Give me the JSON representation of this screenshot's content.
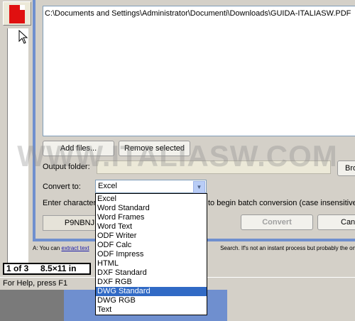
{
  "file_list": {
    "items": [
      "C:\\Documents and Settings\\Administrator\\Documenti\\Downloads\\GUIDA-ITALIASW.PDF"
    ]
  },
  "buttons": {
    "add_files": "Add files...",
    "remove_selected": "Remove selected",
    "browse": "Bro",
    "convert": "Convert",
    "cancel": "Can"
  },
  "output": {
    "label": "Output folder:",
    "value": ""
  },
  "convert_to": {
    "label": "Convert to:",
    "value": "Excel",
    "options": [
      "Excel",
      "Word Standard",
      "Word Frames",
      "Word Text",
      "ODF Writer",
      "ODF Calc",
      "ODF Impress",
      "HTML",
      "DXF Standard",
      "DXF RGB",
      "DWG Standard",
      "DWG RGB",
      "Text"
    ],
    "highlighted": "DWG Standard"
  },
  "instructions": {
    "left": "Enter character",
    "right": "to begin batch conversion (case insensitive):"
  },
  "code": "P9NBNJ",
  "status_line": {
    "prefix": "A: You can",
    "link": "extract text",
    "suffix": "Search.  If's not an instant process but probably the only"
  },
  "page_counter": {
    "pages": "1 of 3",
    "size": "8.5×11 in"
  },
  "status_bar": {
    "help": "For Help, press F1"
  },
  "watermark": "WWW.ITALIASW.COM",
  "colors": {
    "selection": "#316ac5",
    "frame": "#6f8fcf",
    "pdf_red": "#e01010"
  }
}
